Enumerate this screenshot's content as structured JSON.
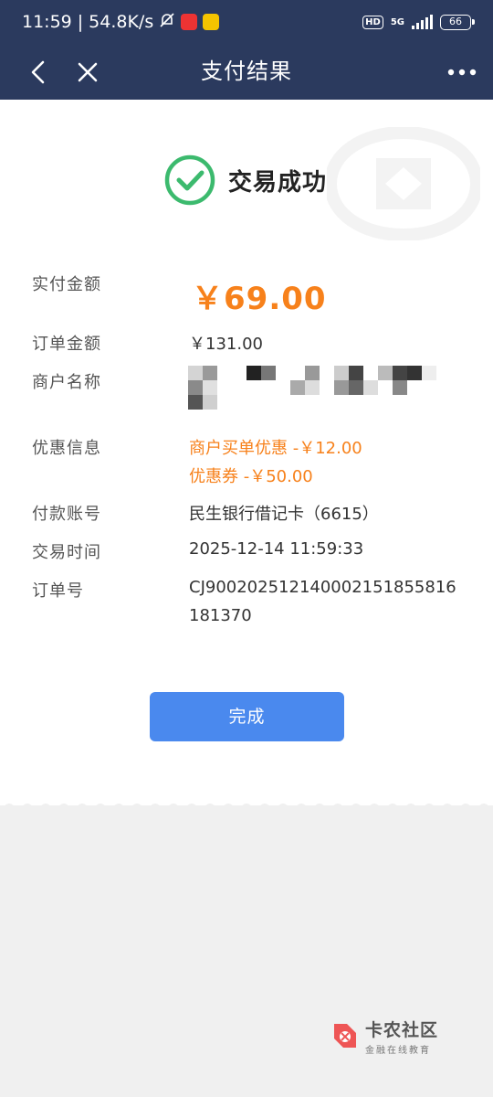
{
  "status_bar": {
    "time": "11:59",
    "speed": "54.8K/s",
    "network_label": "5G",
    "hd_label": "HD",
    "battery": "66"
  },
  "nav": {
    "title": "支付结果"
  },
  "result": {
    "status_text": "交易成功",
    "status_color": "#3cba6e"
  },
  "details": {
    "paid_label": "实付金额",
    "paid_value": "￥69.00",
    "order_amount_label": "订单金额",
    "order_amount_value": "￥131.00",
    "merchant_label": "商户名称",
    "discount_label": "优惠信息",
    "discounts": [
      "商户买单优惠 -￥12.00",
      "优惠券 -￥50.00"
    ],
    "account_label": "付款账号",
    "account_value": "民生银行借记卡（6615）",
    "time_label": "交易时间",
    "time_value": "2025-12-14 11:59:33",
    "order_no_label": "订单号",
    "order_no_value": "CJ900202512140002151855816181370"
  },
  "actions": {
    "done_label": "完成"
  },
  "footer": {
    "brand": "卡农社区",
    "tagline": "金融在线教育"
  },
  "colors": {
    "header": "#2b3a5e",
    "accent_orange": "#f7811b",
    "button_blue": "#4a89ee"
  }
}
